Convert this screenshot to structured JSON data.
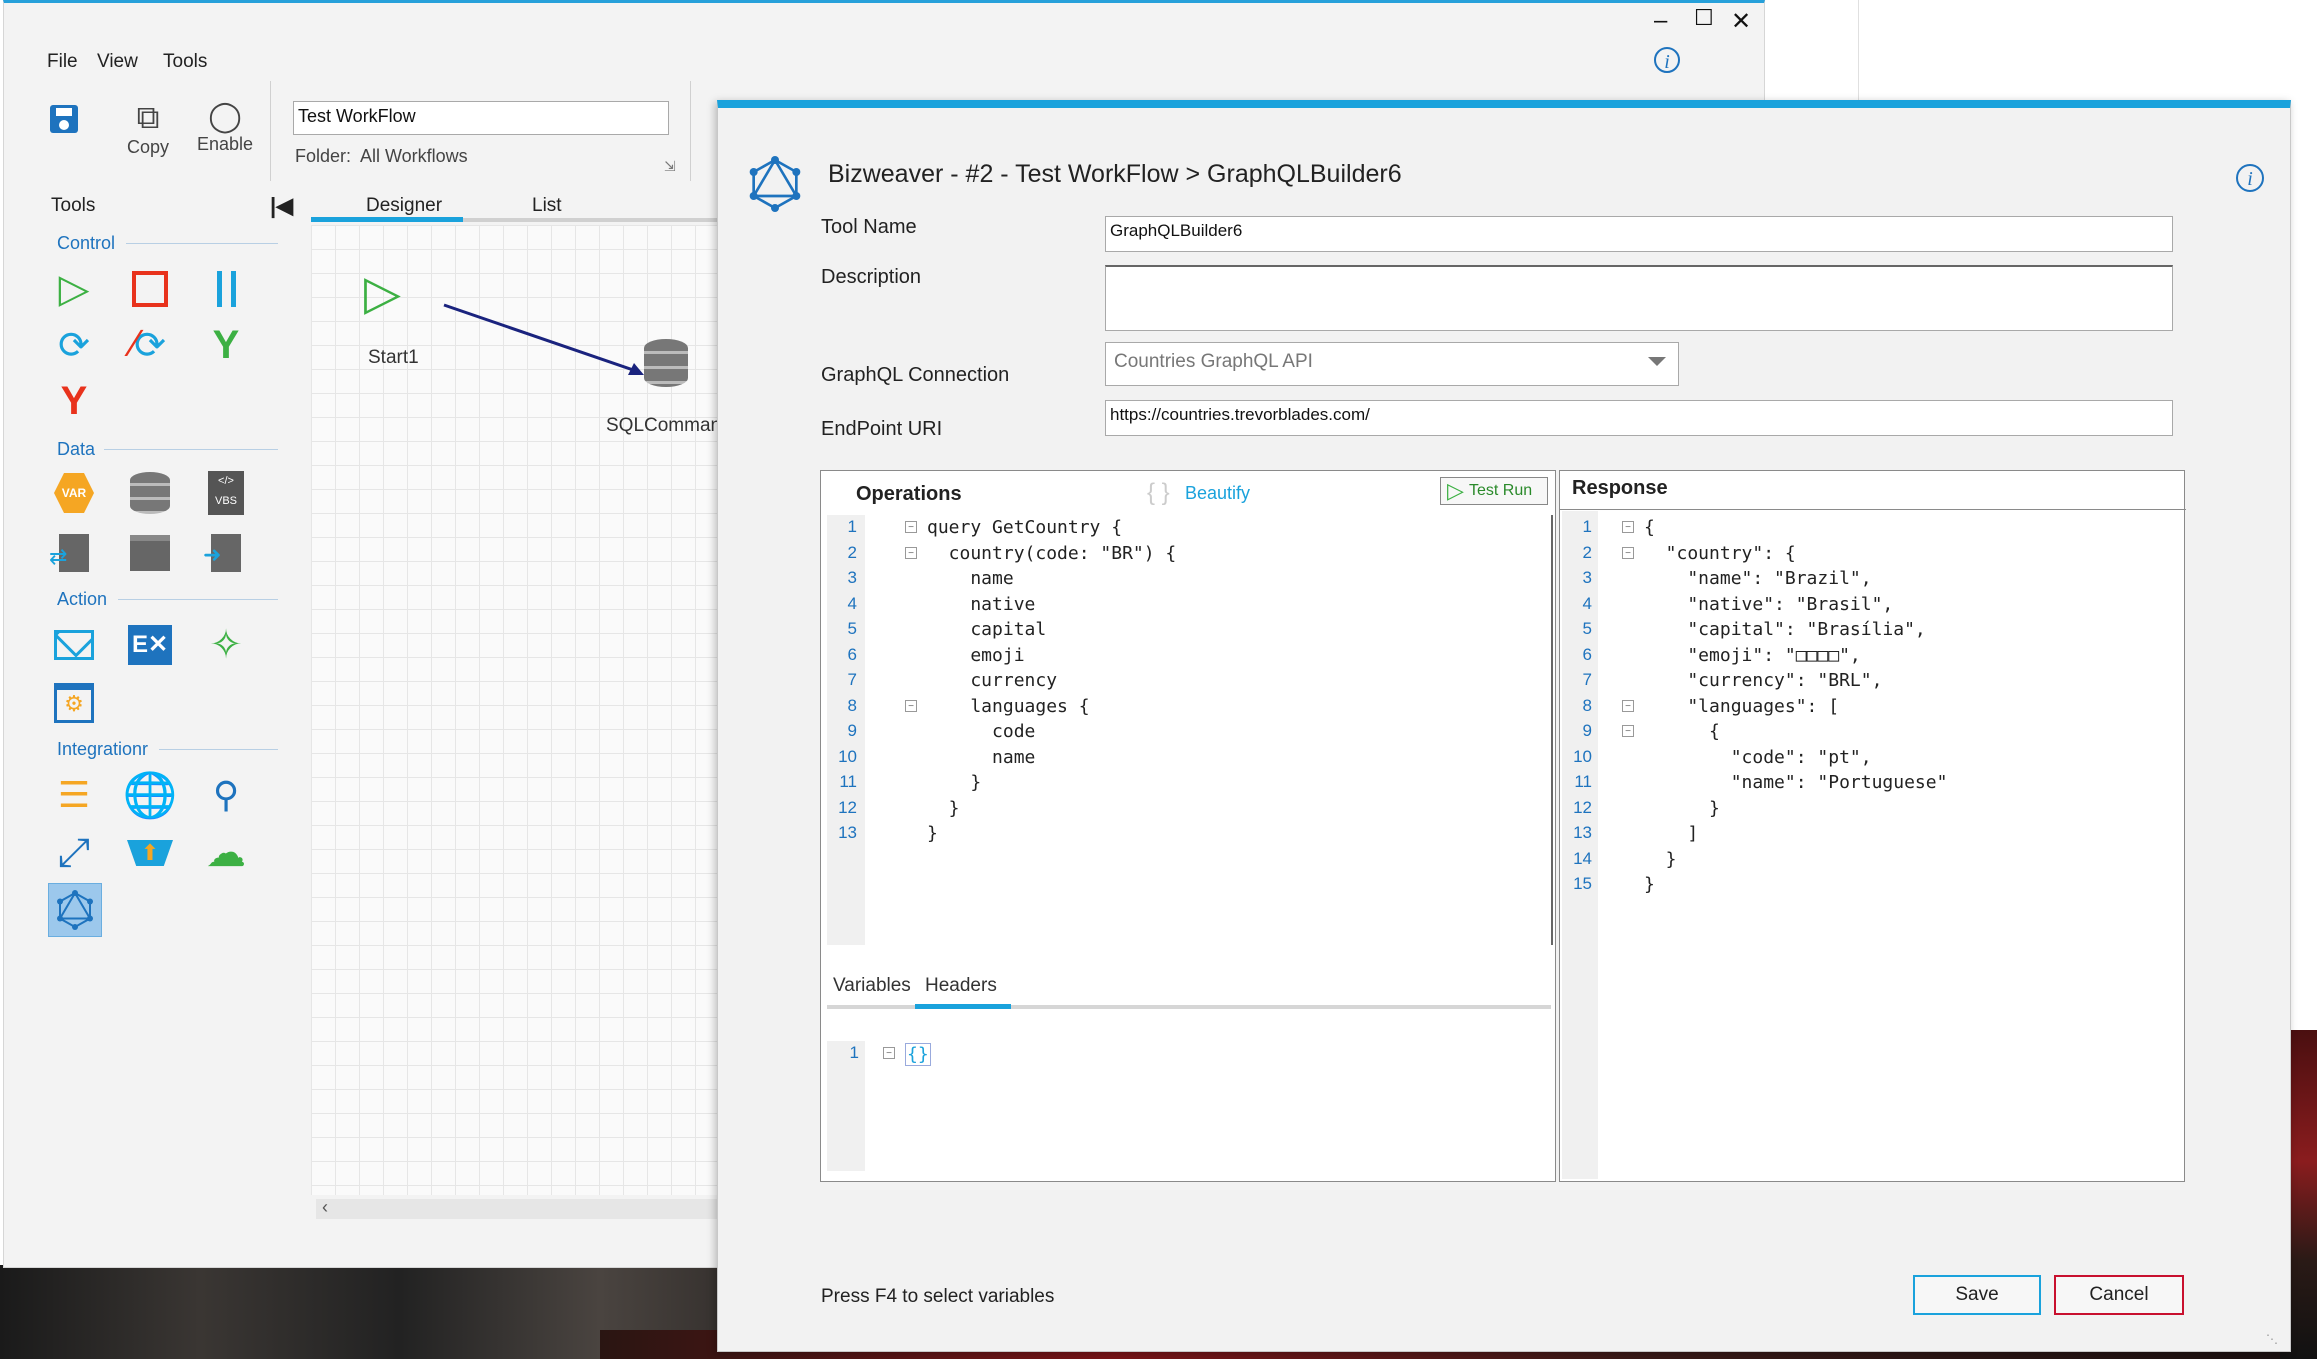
{
  "menu": {
    "file": "File",
    "view": "View",
    "tools": "Tools"
  },
  "ribbon": {
    "copy_label": "Copy",
    "enable_label": "Enable",
    "workflow_name": "Test WorkFlow",
    "folder_label": "Folder:",
    "folder_value": "All Workflows"
  },
  "tools_panel": {
    "title": "Tools",
    "sections": {
      "control": "Control",
      "data": "Data",
      "action": "Action",
      "integration": "Integrationr"
    }
  },
  "designer": {
    "tabs": [
      "Designer",
      "List"
    ],
    "nodes": {
      "start": "Start1",
      "sql": "SQLComman"
    }
  },
  "dialog": {
    "title": "Bizweaver - #2 - Test WorkFlow > GraphQLBuilder6",
    "tool_name_label": "Tool Name",
    "tool_name_value": "GraphQLBuilder6",
    "description_label": "Description",
    "description_value": "",
    "connection_label": "GraphQL Connection",
    "connection_value": "Countries GraphQL API",
    "endpoint_label": "EndPoint URI",
    "endpoint_value": "https://countries.trevorblades.com/",
    "operations_title": "Operations",
    "beautify_label": "Beautify",
    "test_run_label": "Test Run",
    "response_title": "Response",
    "subtabs": [
      "Variables",
      "Headers"
    ],
    "headers_code_line": "{}",
    "hint": "Press F4 to select variables",
    "save_label": "Save",
    "cancel_label": "Cancel"
  },
  "operations_code": [
    "query GetCountry {",
    "  country(code: \"BR\") {",
    "    name",
    "    native",
    "    capital",
    "    emoji",
    "    currency",
    "    languages {",
    "      code",
    "      name",
    "    }",
    "  }",
    "}"
  ],
  "response_code": [
    "{",
    "  \"country\": {",
    "    \"name\": \"Brazil\",",
    "    \"native\": \"Brasil\",",
    "    \"capital\": \"Brasília\",",
    "    \"emoji\": \"□□□□\",",
    "    \"currency\": \"BRL\",",
    "    \"languages\": [",
    "      {",
    "        \"code\": \"pt\",",
    "        \"name\": \"Portuguese\"",
    "      }",
    "    ]",
    "  }",
    "}"
  ],
  "colors": {
    "accent": "#1aa2dc",
    "green": "#3cb043",
    "red": "#e8321c",
    "cancel_border": "#c8102e"
  }
}
